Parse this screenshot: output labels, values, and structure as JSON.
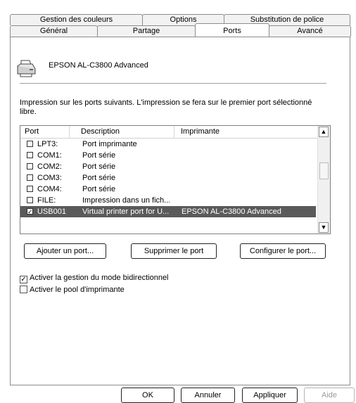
{
  "tabs_row1": [
    {
      "label": "Gestion des couleurs",
      "active": false
    },
    {
      "label": "Options",
      "active": false
    },
    {
      "label": "Substitution de police",
      "active": false
    }
  ],
  "tabs_row2": [
    {
      "label": "Général",
      "active": false
    },
    {
      "label": "Partage",
      "active": false
    },
    {
      "label": "Ports",
      "active": true
    },
    {
      "label": "Avancé",
      "active": false
    }
  ],
  "printer": {
    "name": "EPSON AL-C3800 Advanced",
    "icon": "printer-icon"
  },
  "description": "Impression sur les ports suivants. L'impression se fera sur le premier port sélectionné libre.",
  "port_list": {
    "columns": [
      "Port",
      "Description",
      "Imprimante"
    ],
    "rows": [
      {
        "port": "LPT3:",
        "description": "Port imprimante",
        "printer": "",
        "checked": false,
        "selected": false
      },
      {
        "port": "COM1:",
        "description": "Port série",
        "printer": "",
        "checked": false,
        "selected": false
      },
      {
        "port": "COM2:",
        "description": "Port série",
        "printer": "",
        "checked": false,
        "selected": false
      },
      {
        "port": "COM3:",
        "description": "Port série",
        "printer": "",
        "checked": false,
        "selected": false
      },
      {
        "port": "COM4:",
        "description": "Port série",
        "printer": "",
        "checked": false,
        "selected": false
      },
      {
        "port": "FILE:",
        "description": "Impression dans un fich...",
        "printer": "",
        "checked": false,
        "selected": false
      },
      {
        "port": "USB001",
        "description": "Virtual printer port for U...",
        "printer": "EPSON AL-C3800 Advanced",
        "checked": true,
        "selected": true
      }
    ]
  },
  "port_buttons": {
    "add": "Ajouter un port...",
    "delete": "Supprimer le port",
    "configure": "Configurer le port..."
  },
  "options": {
    "bidirectional": {
      "label": "Activer la gestion du mode bidirectionnel",
      "checked": true
    },
    "pool": {
      "label": "Activer le pool d'imprimante",
      "checked": false
    }
  },
  "footer_buttons": {
    "ok": "OK",
    "cancel": "Annuler",
    "apply": "Appliquer",
    "help": "Aide"
  }
}
